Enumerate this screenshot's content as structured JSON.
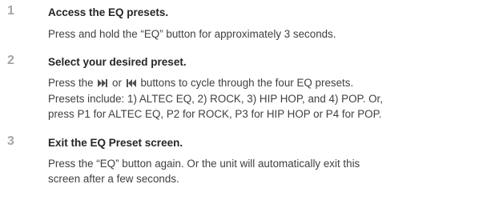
{
  "steps": [
    {
      "number": "1",
      "title": "Access the EQ presets.",
      "body": [
        "Press and hold the “EQ” button for approximately 3 seconds."
      ]
    },
    {
      "number": "2",
      "title": "Select your desired preset.",
      "body_parts": {
        "before": "Press the",
        "middle": "or",
        "after": "buttons to cycle through the four EQ presets."
      },
      "body": [
        "Presets include: 1) ALTEC EQ, 2) ROCK, 3) HIP HOP, and 4) POP. Or,",
        "press P1 for ALTEC EQ, P2 for ROCK, P3 for HIP HOP or P4 for POP."
      ],
      "icons": [
        "skip-forward-icon",
        "skip-back-icon"
      ]
    },
    {
      "number": "3",
      "title": "Exit the EQ Preset screen.",
      "body": [
        "Press the “EQ” button again. Or the unit will automatically exit this",
        "screen after a few seconds."
      ]
    }
  ],
  "colors": {
    "step_number": "#a6a6a6",
    "title": "#262626",
    "body": "#404040"
  }
}
